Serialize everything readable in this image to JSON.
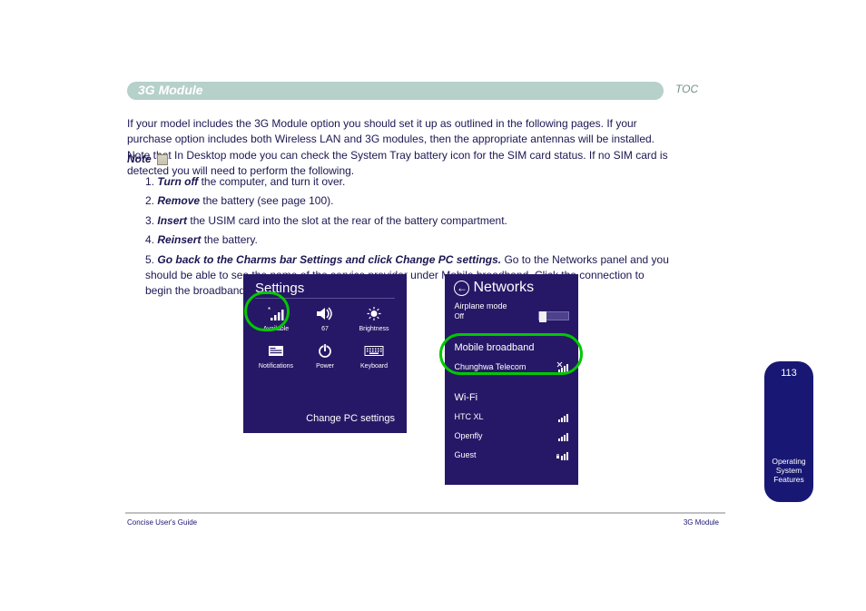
{
  "header": {
    "title": "3G Module",
    "toc": "TOC"
  },
  "intro": "If your model includes the 3G Module option you should set it up as outlined in the following pages. If your purchase option includes both Wireless LAN and 3G modules, then the appropriate antennas will be installed. Note that In Desktop mode you can check the System Tray battery icon for the SIM card status. If no SIM card is detected you will need to perform the following.",
  "subheading": "Note",
  "list": [
    {
      "num": "1.",
      "term": "Turn off",
      "rest": " the computer, and turn it over."
    },
    {
      "num": "2.",
      "term": "Remove",
      "rest": " the battery (see page 100)."
    },
    {
      "num": "3.",
      "term": "Insert",
      "rest": " the USIM card into the slot at the rear of the battery compartment."
    },
    {
      "num": "4.",
      "term": "Reinsert",
      "rest": " the battery."
    },
    {
      "num": "5.",
      "term": "Go back to the Charms bar Settings and click Change PC settings.",
      "rest": " Go to the Networks panel and you should be able to see the name of the service provider under Mobile broadband. Click the connection to begin the broadband connection process."
    }
  ],
  "settings": {
    "title": "Settings",
    "items": [
      {
        "label": "Available",
        "icon": "signal"
      },
      {
        "label": "67",
        "icon": "volume"
      },
      {
        "label": "Brightness",
        "icon": "brightness"
      },
      {
        "label": "Notifications",
        "icon": "notifications"
      },
      {
        "label": "Power",
        "icon": "power"
      },
      {
        "label": "Keyboard",
        "icon": "keyboard"
      }
    ],
    "change": "Change PC settings"
  },
  "networks": {
    "title": "Networks",
    "airplane_label": "Airplane mode",
    "airplane_state": "Off",
    "mobile_label": "Mobile broadband",
    "mobile_provider": "Chunghwa Telecom",
    "wifi_label": "Wi-Fi",
    "wifi_items": [
      "HTC XL",
      "Openfly",
      "Guest"
    ]
  },
  "tab": {
    "page": "113",
    "caption": "Operating System Features"
  },
  "footer": {
    "left": "Concise User's Guide",
    "right": "3G Module"
  }
}
